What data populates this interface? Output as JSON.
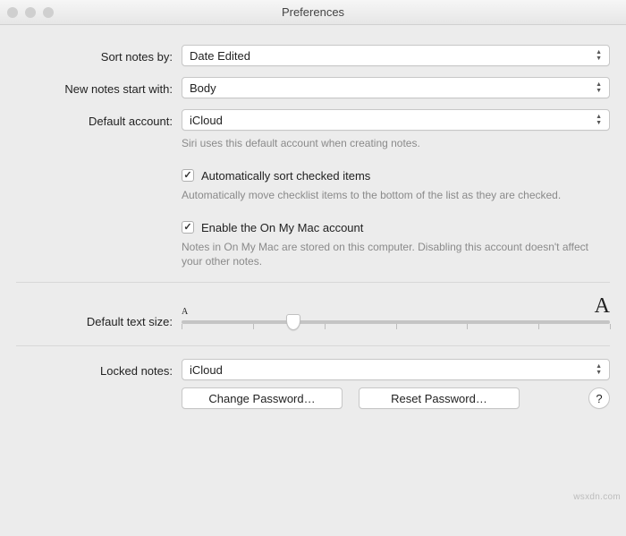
{
  "window": {
    "title": "Preferences"
  },
  "sort": {
    "label": "Sort notes by:",
    "value": "Date Edited"
  },
  "start": {
    "label": "New notes start with:",
    "value": "Body"
  },
  "account": {
    "label": "Default account:",
    "value": "iCloud",
    "help": "Siri uses this default account when creating notes."
  },
  "autosort": {
    "checked": true,
    "label": "Automatically sort checked items",
    "help": "Automatically move checklist items to the bottom of the list as they are checked."
  },
  "onmymac": {
    "checked": true,
    "label": "Enable the On My Mac account",
    "help": "Notes in On My Mac are stored on this computer. Disabling this account doesn't affect your other notes."
  },
  "textsize": {
    "label": "Default text size:",
    "min_marker": "A",
    "max_marker": "A",
    "value_percent": 26
  },
  "locked": {
    "label": "Locked notes:",
    "value": "iCloud"
  },
  "buttons": {
    "change_pw": "Change Password…",
    "reset_pw": "Reset Password…",
    "help": "?"
  },
  "watermark": "wsxdn.com"
}
